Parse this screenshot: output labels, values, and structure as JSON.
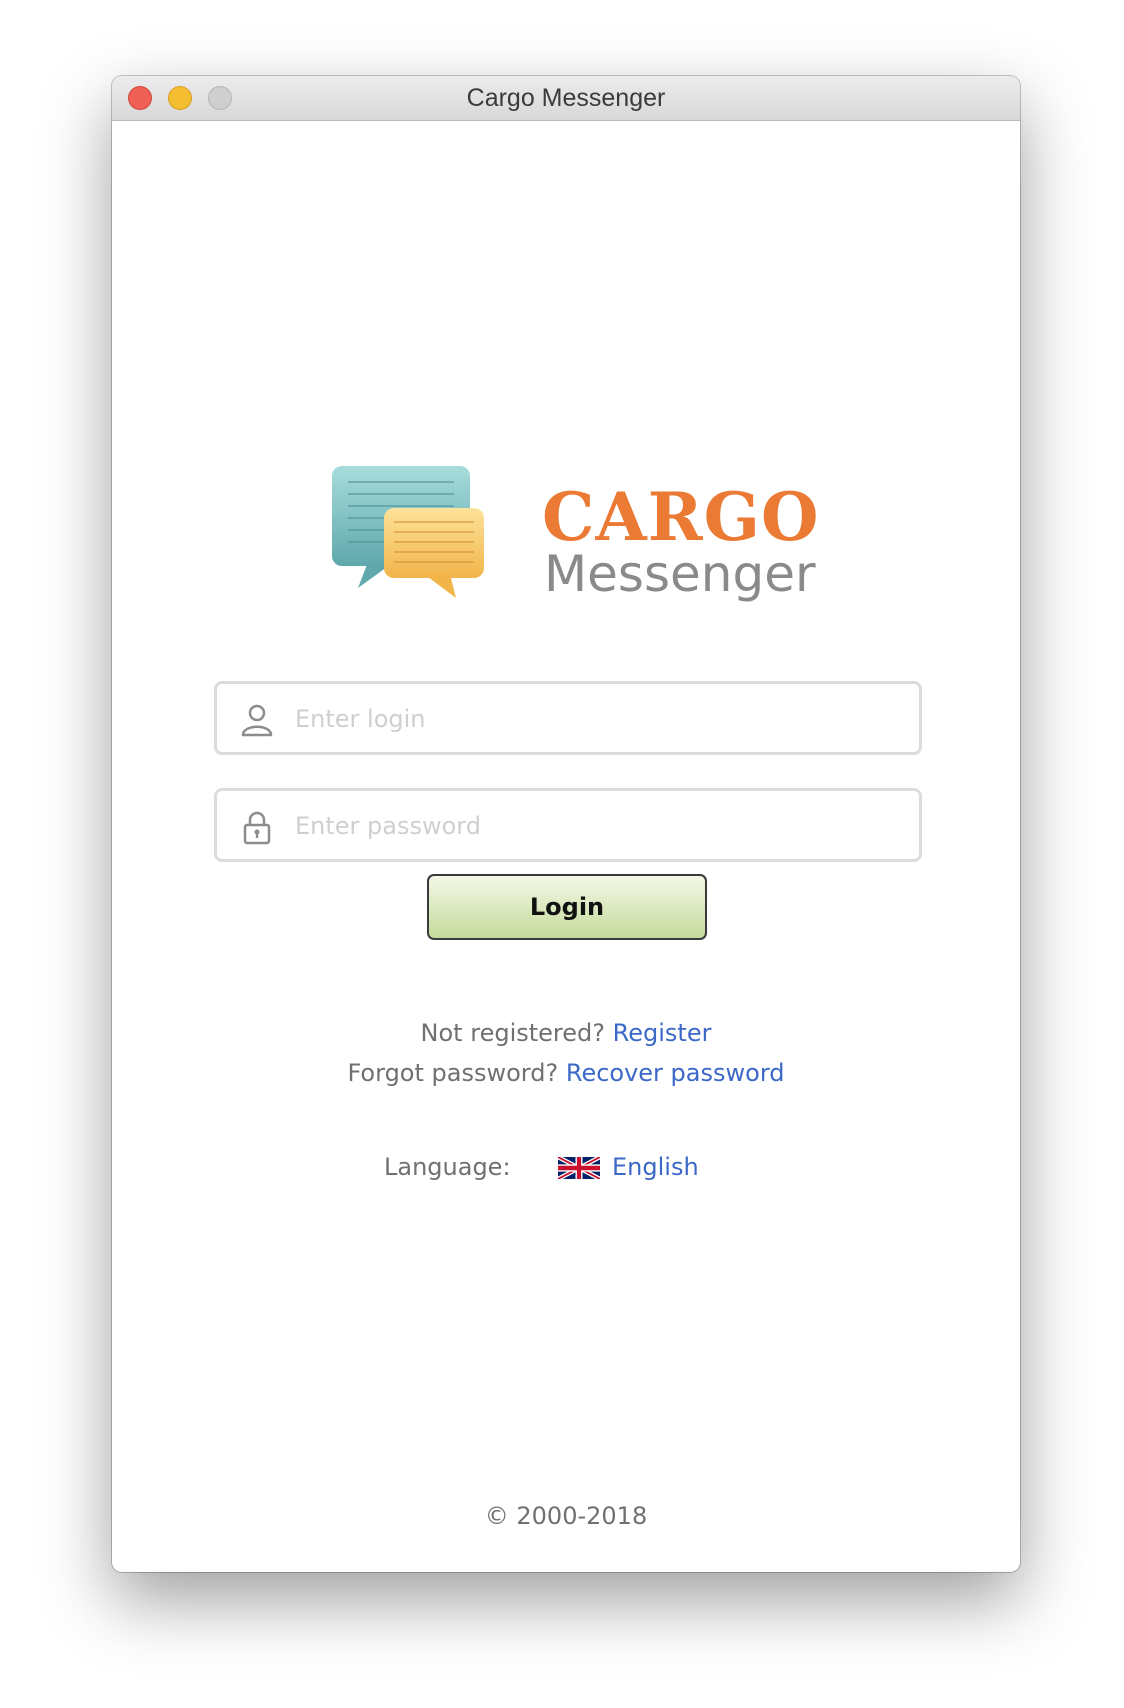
{
  "window": {
    "title": "Cargo Messenger"
  },
  "logo": {
    "brand": "CARGO",
    "subtitle": "Messenger",
    "icon": "chat-bubbles-icon",
    "colors": {
      "brand": "#ea7a34",
      "subtitle": "#8a8a8a",
      "bubble_back": "#7fc2c4",
      "bubble_front": "#f7c96a"
    }
  },
  "form": {
    "login": {
      "placeholder": "Enter login",
      "value": "",
      "icon": "user-icon"
    },
    "password": {
      "placeholder": "Enter password",
      "value": "",
      "icon": "lock-icon"
    },
    "submit_label": "Login"
  },
  "links": {
    "not_registered_text": "Not registered?",
    "register_label": "Register",
    "forgot_text": "Forgot password?",
    "recover_label": "Recover password",
    "link_color": "#3c68c8"
  },
  "language": {
    "label": "Language:",
    "value": "English",
    "flag": "uk-flag-icon"
  },
  "footer": {
    "copyright": "© 2000-2018"
  }
}
